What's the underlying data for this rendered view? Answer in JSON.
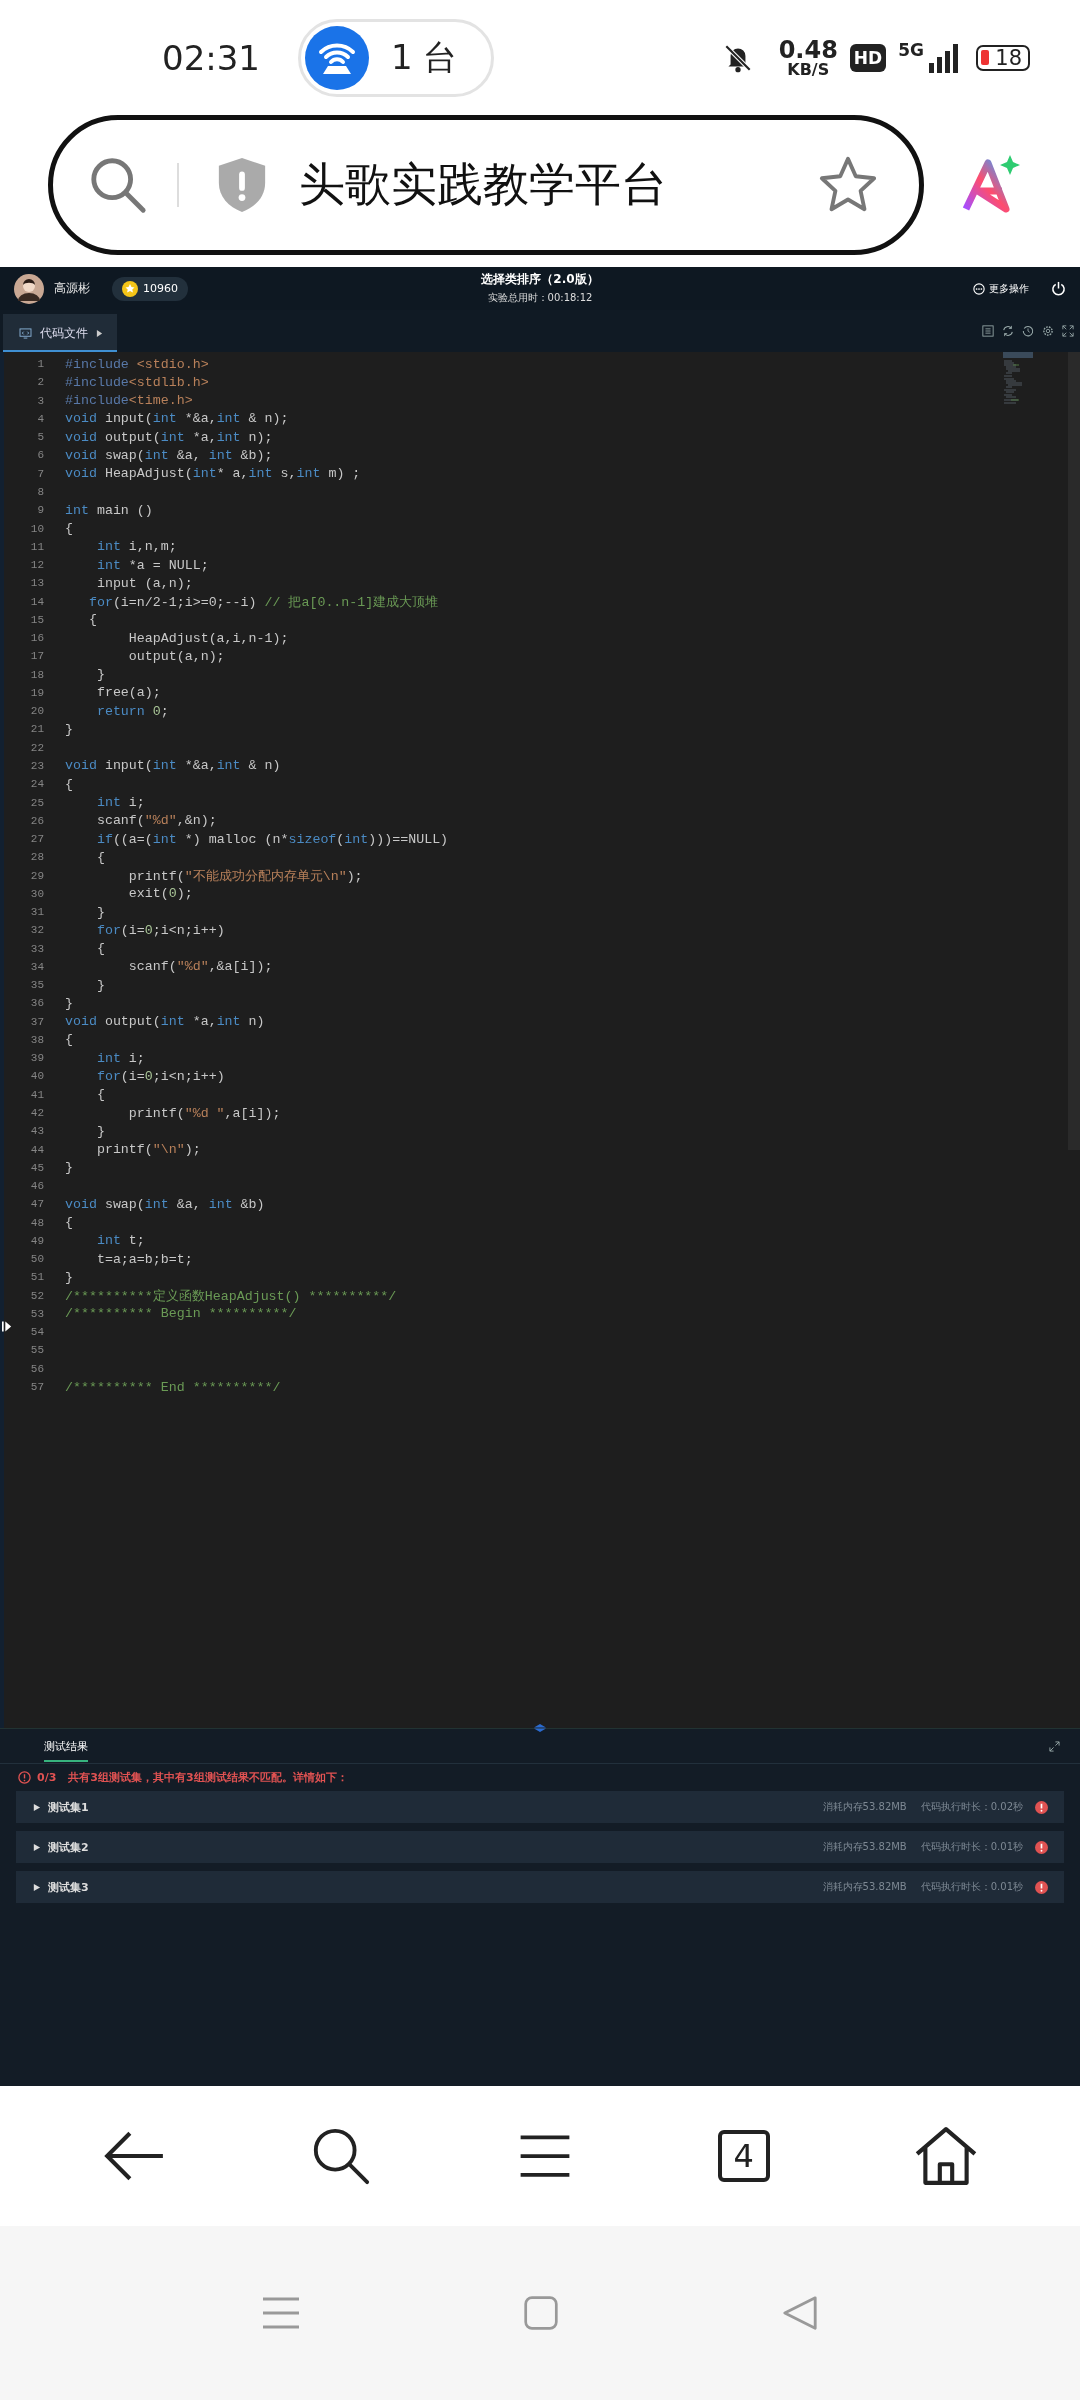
{
  "status_bar": {
    "time": "02:31",
    "hotspot_count": "1 台",
    "speed": "0.48",
    "speed_unit": "KB/S",
    "hd": "HD",
    "network": "5G",
    "battery": "18"
  },
  "address_bar": {
    "title": "头歌实践教学平台"
  },
  "header": {
    "user": "高源彬",
    "coins": "10960",
    "title": "选择类排序（2.0版）",
    "timer": "实验总用时：00:18:12",
    "more": "更多操作"
  },
  "tabs": [
    {
      "label": "代码文件",
      "selected": true
    }
  ],
  "code": [
    {
      "number": "1",
      "tokens": [
        {
          "kind": "pp",
          "text": "#include "
        },
        {
          "kind": "str",
          "text": "<stdio.h>"
        }
      ]
    },
    {
      "number": "2",
      "tokens": [
        {
          "kind": "pp",
          "text": "#include"
        },
        {
          "kind": "str",
          "text": "<stdlib.h>"
        }
      ]
    },
    {
      "number": "3",
      "tokens": [
        {
          "kind": "pp",
          "text": "#include"
        },
        {
          "kind": "str",
          "text": "<time.h>"
        }
      ]
    },
    {
      "number": "4",
      "tokens": [
        {
          "kind": "kw",
          "text": "void"
        },
        {
          "kind": "p",
          "text": " input("
        },
        {
          "kind": "kw",
          "text": "int"
        },
        {
          "kind": "p",
          "text": " *&a,"
        },
        {
          "kind": "kw",
          "text": "int"
        },
        {
          "kind": "p",
          "text": " & n);"
        }
      ]
    },
    {
      "number": "5",
      "tokens": [
        {
          "kind": "kw",
          "text": "void"
        },
        {
          "kind": "p",
          "text": " output("
        },
        {
          "kind": "kw",
          "text": "int"
        },
        {
          "kind": "p",
          "text": " *a,"
        },
        {
          "kind": "kw",
          "text": "int"
        },
        {
          "kind": "p",
          "text": " n);"
        }
      ]
    },
    {
      "number": "6",
      "tokens": [
        {
          "kind": "kw",
          "text": "void"
        },
        {
          "kind": "p",
          "text": " swap("
        },
        {
          "kind": "kw",
          "text": "int"
        },
        {
          "kind": "p",
          "text": " &a, "
        },
        {
          "kind": "kw",
          "text": "int"
        },
        {
          "kind": "p",
          "text": " &b);"
        }
      ]
    },
    {
      "number": "7",
      "tokens": [
        {
          "kind": "kw",
          "text": "void"
        },
        {
          "kind": "p",
          "text": " HeapAdjust("
        },
        {
          "kind": "kw",
          "text": "int"
        },
        {
          "kind": "p",
          "text": "* a,"
        },
        {
          "kind": "kw",
          "text": "int"
        },
        {
          "kind": "p",
          "text": " s,"
        },
        {
          "kind": "kw",
          "text": "int"
        },
        {
          "kind": "p",
          "text": " m) ;"
        }
      ]
    },
    {
      "number": "8"
    },
    {
      "number": "9",
      "tokens": [
        {
          "kind": "kw",
          "text": "int"
        },
        {
          "kind": "p",
          "text": " main ()"
        }
      ]
    },
    {
      "number": "10",
      "tokens": [
        {
          "kind": "p",
          "text": "{"
        }
      ]
    },
    {
      "number": "11",
      "tokens": [
        {
          "kind": "kw",
          "text": "    int"
        },
        {
          "kind": "p",
          "text": " i,n,m;"
        }
      ]
    },
    {
      "number": "12",
      "tokens": [
        {
          "kind": "kw",
          "text": "    int"
        },
        {
          "kind": "p",
          "text": " *a = NULL;"
        }
      ]
    },
    {
      "number": "13",
      "tokens": [
        {
          "kind": "p",
          "text": "    input (a,n);"
        }
      ]
    },
    {
      "number": "14",
      "tokens": [
        {
          "kind": "kw",
          "text": "   for"
        },
        {
          "kind": "p",
          "text": "(i=n/2-1;i>=0;--i) "
        },
        {
          "kind": "cm",
          "text": "// 把a[0..n-1]建成大顶堆"
        }
      ]
    },
    {
      "number": "15",
      "tokens": [
        {
          "kind": "p",
          "text": "   {"
        }
      ]
    },
    {
      "number": "16",
      "tokens": [
        {
          "kind": "p",
          "text": "        HeapAdjust(a,i,n-1);"
        }
      ]
    },
    {
      "number": "17",
      "tokens": [
        {
          "kind": "p",
          "text": "        output(a,n);"
        }
      ]
    },
    {
      "number": "18",
      "tokens": [
        {
          "kind": "p",
          "text": "    }"
        }
      ]
    },
    {
      "number": "19",
      "tokens": [
        {
          "kind": "p",
          "text": "    free(a);"
        }
      ]
    },
    {
      "number": "20",
      "tokens": [
        {
          "kind": "kw",
          "text": "    return "
        },
        {
          "kind": "num",
          "text": "0"
        },
        {
          "kind": "p",
          "text": ";"
        }
      ]
    },
    {
      "number": "21",
      "tokens": [
        {
          "kind": "p",
          "text": "}"
        }
      ]
    },
    {
      "number": "22"
    },
    {
      "number": "23",
      "tokens": [
        {
          "kind": "kw",
          "text": "void"
        },
        {
          "kind": "p",
          "text": " input("
        },
        {
          "kind": "kw",
          "text": "int"
        },
        {
          "kind": "p",
          "text": " *&a,"
        },
        {
          "kind": "kw",
          "text": "int"
        },
        {
          "kind": "p",
          "text": " & n)"
        }
      ]
    },
    {
      "number": "24",
      "tokens": [
        {
          "kind": "p",
          "text": "{"
        }
      ]
    },
    {
      "number": "25",
      "tokens": [
        {
          "kind": "kw",
          "text": "    int"
        },
        {
          "kind": "p",
          "text": " i;"
        }
      ]
    },
    {
      "number": "26",
      "tokens": [
        {
          "kind": "p",
          "text": "    scanf("
        },
        {
          "kind": "str",
          "text": "\"%d\""
        },
        {
          "kind": "p",
          "text": ",&n);"
        }
      ]
    },
    {
      "number": "27",
      "tokens": [
        {
          "kind": "kw",
          "text": "    if"
        },
        {
          "kind": "p",
          "text": "((a=("
        },
        {
          "kind": "kw",
          "text": "int"
        },
        {
          "kind": "p",
          "text": " *) malloc (n*"
        },
        {
          "kind": "kw",
          "text": "sizeof"
        },
        {
          "kind": "p",
          "text": "("
        },
        {
          "kind": "kw",
          "text": "int"
        },
        {
          "kind": "p",
          "text": ")))==NULL)"
        }
      ]
    },
    {
      "number": "28",
      "tokens": [
        {
          "kind": "p",
          "text": "    {"
        }
      ]
    },
    {
      "number": "29",
      "tokens": [
        {
          "kind": "p",
          "text": "        printf("
        },
        {
          "kind": "str",
          "text": "\"不能成功分配内存单元\\n\""
        },
        {
          "kind": "p",
          "text": ");"
        }
      ]
    },
    {
      "number": "30",
      "tokens": [
        {
          "kind": "p",
          "text": "        exit("
        },
        {
          "kind": "num",
          "text": "0"
        },
        {
          "kind": "p",
          "text": ");"
        }
      ]
    },
    {
      "number": "31",
      "tokens": [
        {
          "kind": "p",
          "text": "    }"
        }
      ]
    },
    {
      "number": "32",
      "tokens": [
        {
          "kind": "kw",
          "text": "    for"
        },
        {
          "kind": "p",
          "text": "(i="
        },
        {
          "kind": "num",
          "text": "0"
        },
        {
          "kind": "p",
          "text": ";i<n;i++)"
        }
      ]
    },
    {
      "number": "33",
      "tokens": [
        {
          "kind": "p",
          "text": "    {"
        }
      ]
    },
    {
      "number": "34",
      "tokens": [
        {
          "kind": "p",
          "text": "        scanf("
        },
        {
          "kind": "str",
          "text": "\"%d\""
        },
        {
          "kind": "p",
          "text": ",&a[i]);"
        }
      ]
    },
    {
      "number": "35",
      "tokens": [
        {
          "kind": "p",
          "text": "    }"
        }
      ]
    },
    {
      "number": "36",
      "tokens": [
        {
          "kind": "p",
          "text": "}"
        }
      ]
    },
    {
      "number": "37",
      "tokens": [
        {
          "kind": "kw",
          "text": "void"
        },
        {
          "kind": "p",
          "text": " output("
        },
        {
          "kind": "kw",
          "text": "int"
        },
        {
          "kind": "p",
          "text": " *a,"
        },
        {
          "kind": "kw",
          "text": "int"
        },
        {
          "kind": "p",
          "text": " n)"
        }
      ]
    },
    {
      "number": "38",
      "tokens": [
        {
          "kind": "p",
          "text": "{"
        }
      ]
    },
    {
      "number": "39",
      "tokens": [
        {
          "kind": "kw",
          "text": "    int"
        },
        {
          "kind": "p",
          "text": " i;"
        }
      ]
    },
    {
      "number": "40",
      "tokens": [
        {
          "kind": "kw",
          "text": "    for"
        },
        {
          "kind": "p",
          "text": "(i="
        },
        {
          "kind": "num",
          "text": "0"
        },
        {
          "kind": "p",
          "text": ";i<n;i++)"
        }
      ]
    },
    {
      "number": "41",
      "tokens": [
        {
          "kind": "p",
          "text": "    {"
        }
      ]
    },
    {
      "number": "42",
      "tokens": [
        {
          "kind": "p",
          "text": "        printf("
        },
        {
          "kind": "str",
          "text": "\"%d \""
        },
        {
          "kind": "p",
          "text": ",a[i]);"
        }
      ]
    },
    {
      "number": "43",
      "tokens": [
        {
          "kind": "p",
          "text": "    }"
        }
      ]
    },
    {
      "number": "44",
      "tokens": [
        {
          "kind": "p",
          "text": "    printf("
        },
        {
          "kind": "str",
          "text": "\"\\n\""
        },
        {
          "kind": "p",
          "text": ");"
        }
      ]
    },
    {
      "number": "45",
      "tokens": [
        {
          "kind": "p",
          "text": "}"
        }
      ]
    },
    {
      "number": "46"
    },
    {
      "number": "47",
      "tokens": [
        {
          "kind": "kw",
          "text": "void"
        },
        {
          "kind": "p",
          "text": " swap("
        },
        {
          "kind": "kw",
          "text": "int"
        },
        {
          "kind": "p",
          "text": " &a, "
        },
        {
          "kind": "kw",
          "text": "int"
        },
        {
          "kind": "p",
          "text": " &b)"
        }
      ]
    },
    {
      "number": "48",
      "tokens": [
        {
          "kind": "p",
          "text": "{"
        }
      ]
    },
    {
      "number": "49",
      "tokens": [
        {
          "kind": "kw",
          "text": "    int"
        },
        {
          "kind": "p",
          "text": " t;"
        }
      ]
    },
    {
      "number": "50",
      "tokens": [
        {
          "kind": "p",
          "text": "    t=a;a=b;b=t;"
        }
      ]
    },
    {
      "number": "51",
      "tokens": [
        {
          "kind": "p",
          "text": "}"
        }
      ]
    },
    {
      "number": "52",
      "tokens": [
        {
          "kind": "cm",
          "text": "/**********定义函数HeapAdjust() **********/"
        }
      ]
    },
    {
      "number": "53",
      "tokens": [
        {
          "kind": "cm",
          "text": "/********** Begin **********/"
        }
      ]
    },
    {
      "number": "54"
    },
    {
      "number": "55"
    },
    {
      "number": "56"
    },
    {
      "number": "57",
      "tokens": [
        {
          "kind": "cm",
          "text": "/********** End **********/"
        }
      ]
    }
  ],
  "results": {
    "tabs": [
      {
        "label": "测试结果",
        "selected": true
      }
    ],
    "score": "0/3",
    "summary": "共有3组测试集，其中有3组测试结果不匹配。详情如下：",
    "sets": [
      {
        "name": "测试集1",
        "memory": "消耗内存53.82MB",
        "duration": "代码执行时长：0.02秒",
        "expanded": false,
        "passed": false
      },
      {
        "name": "测试集2",
        "memory": "消耗内存53.82MB",
        "duration": "代码执行时长：0.01秒",
        "expanded": false,
        "passed": false
      },
      {
        "name": "测试集3",
        "memory": "消耗内存53.82MB",
        "duration": "代码执行时长：0.01秒",
        "expanded": false,
        "passed": false
      }
    ]
  },
  "browser_toolbar": {
    "tab_count": "4"
  }
}
